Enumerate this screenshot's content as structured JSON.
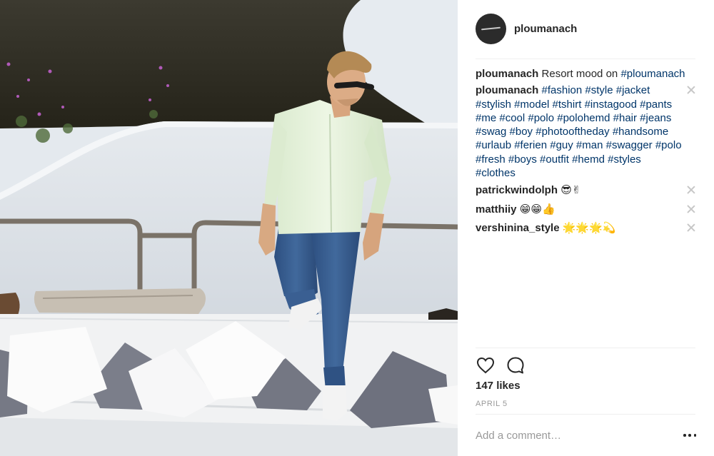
{
  "post": {
    "image_alt": "Man in light green shirt and blue jeans stepping onto a white outdoor lounge with cushions"
  },
  "header": {
    "username": "ploumanach"
  },
  "caption": {
    "user": "ploumanach",
    "text": "Resort mood on",
    "hashtag": "#ploumanach"
  },
  "comments": [
    {
      "user": "ploumanach",
      "text": "#fashion #style #jacket #stylish #model #tshirt #instagood #pants #me #cool #polo #polohemd #hair #jeans #swag #boy #photooftheday #handsome #urlaub #ferien #guy #man #swagger #polo #fresh #boys #outfit #hemd #styles #clothes"
    },
    {
      "user": "patrickwindolph",
      "text": "😎✌"
    },
    {
      "user": "matthiiy",
      "text": "😁😁👍"
    },
    {
      "user": "vershinina_style",
      "text": "🌟🌟🌟💫"
    }
  ],
  "actions": {
    "like_icon": "heart-icon",
    "comment_icon": "speech-bubble-icon"
  },
  "likes": "147 likes",
  "date": "APRIL 5",
  "add_comment": {
    "placeholder": "Add a comment…"
  },
  "more_icon": "ellipsis-icon"
}
